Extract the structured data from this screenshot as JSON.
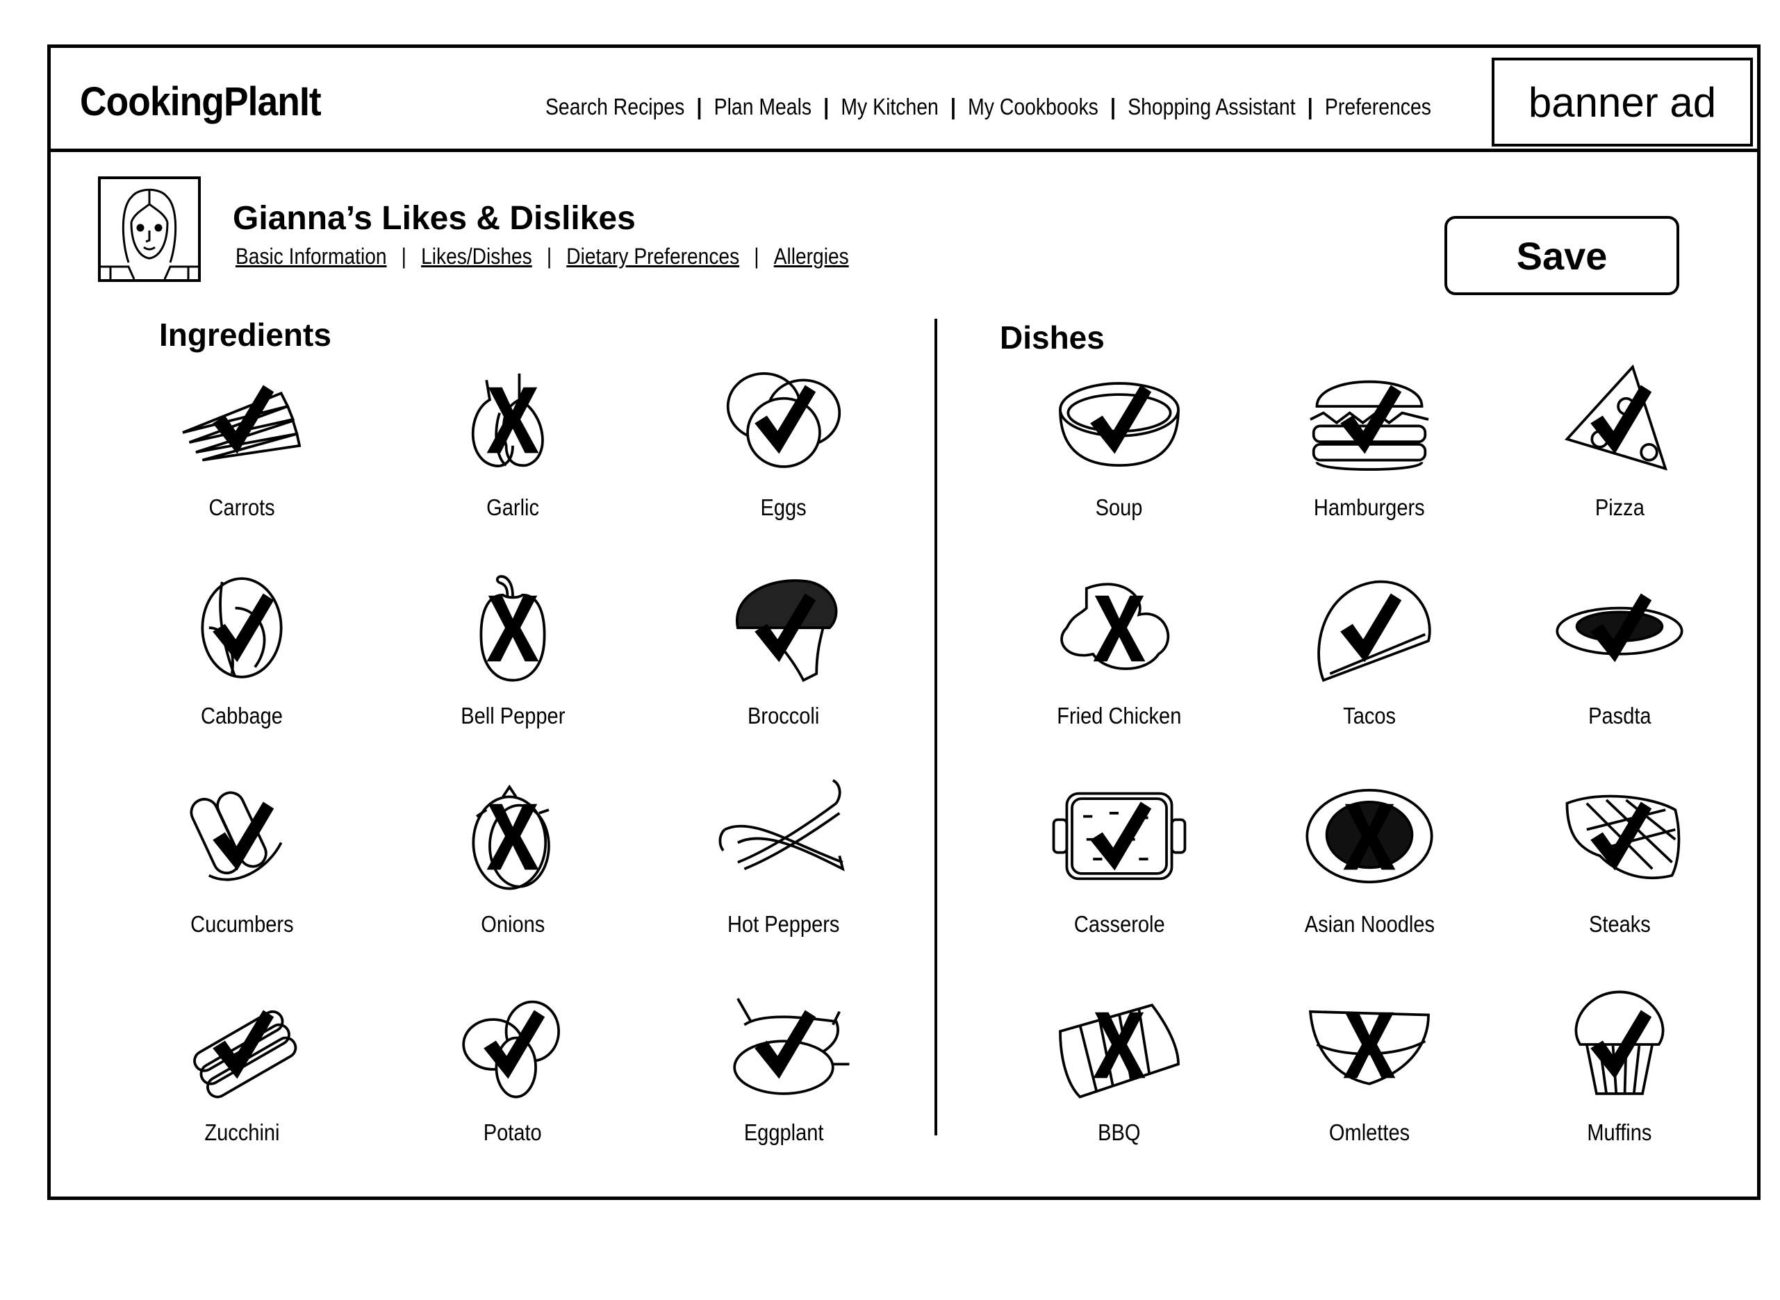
{
  "app": {
    "name": "CookingPlanIt"
  },
  "nav": {
    "items": [
      "Search Recipes",
      "Plan Meals",
      "My Kitchen",
      "My Cookbooks",
      "Shopping Assistant",
      "Preferences"
    ],
    "separator": "|"
  },
  "banner": {
    "label": "banner ad"
  },
  "profile": {
    "title": "Gianna’s Likes & Dislikes",
    "avatar_icon": "woman-portrait-icon",
    "tabs": [
      "Basic Information",
      "Likes/Dishes",
      "Dietary Preferences",
      "Allergies"
    ],
    "separator": "|"
  },
  "save_button": {
    "label": "Save"
  },
  "ingredients": {
    "heading": "Ingredients",
    "items": [
      {
        "label": "Carrots",
        "icon": "carrots-icon",
        "status": "like"
      },
      {
        "label": "Garlic",
        "icon": "garlic-icon",
        "status": "dislike"
      },
      {
        "label": "Eggs",
        "icon": "eggs-icon",
        "status": "like"
      },
      {
        "label": "Cabbage",
        "icon": "cabbage-icon",
        "status": "like"
      },
      {
        "label": "Bell Pepper",
        "icon": "bell-pepper-icon",
        "status": "dislike"
      },
      {
        "label": "Broccoli",
        "icon": "broccoli-icon",
        "status": "like"
      },
      {
        "label": "Cucumbers",
        "icon": "cucumbers-icon",
        "status": "like"
      },
      {
        "label": "Onions",
        "icon": "onions-icon",
        "status": "dislike"
      },
      {
        "label": "Hot Peppers",
        "icon": "hot-peppers-icon",
        "status": "none"
      },
      {
        "label": "Zucchini",
        "icon": "zucchini-icon",
        "status": "like"
      },
      {
        "label": "Potato",
        "icon": "potato-icon",
        "status": "like"
      },
      {
        "label": "Eggplant",
        "icon": "eggplant-icon",
        "status": "like"
      }
    ]
  },
  "dishes": {
    "heading": "Dishes",
    "items": [
      {
        "label": "Soup",
        "icon": "soup-icon",
        "status": "like"
      },
      {
        "label": "Hamburgers",
        "icon": "hamburger-icon",
        "status": "like"
      },
      {
        "label": "Pizza",
        "icon": "pizza-icon",
        "status": "like"
      },
      {
        "label": "Fried Chicken",
        "icon": "fried-chicken-icon",
        "status": "dislike"
      },
      {
        "label": "Tacos",
        "icon": "taco-icon",
        "status": "like"
      },
      {
        "label": "Pasdta",
        "icon": "pasta-icon",
        "status": "like"
      },
      {
        "label": "Casserole",
        "icon": "casserole-icon",
        "status": "like"
      },
      {
        "label": "Asian Noodles",
        "icon": "asian-noodles-icon",
        "status": "dislike"
      },
      {
        "label": "Steaks",
        "icon": "steak-icon",
        "status": "like"
      },
      {
        "label": "BBQ",
        "icon": "bbq-ribs-icon",
        "status": "dislike"
      },
      {
        "label": "Omlettes",
        "icon": "omelette-icon",
        "status": "dislike"
      },
      {
        "label": "Muffins",
        "icon": "muffin-icon",
        "status": "like"
      }
    ]
  },
  "colors": {
    "ink": "#000000",
    "paper": "#ffffff"
  }
}
